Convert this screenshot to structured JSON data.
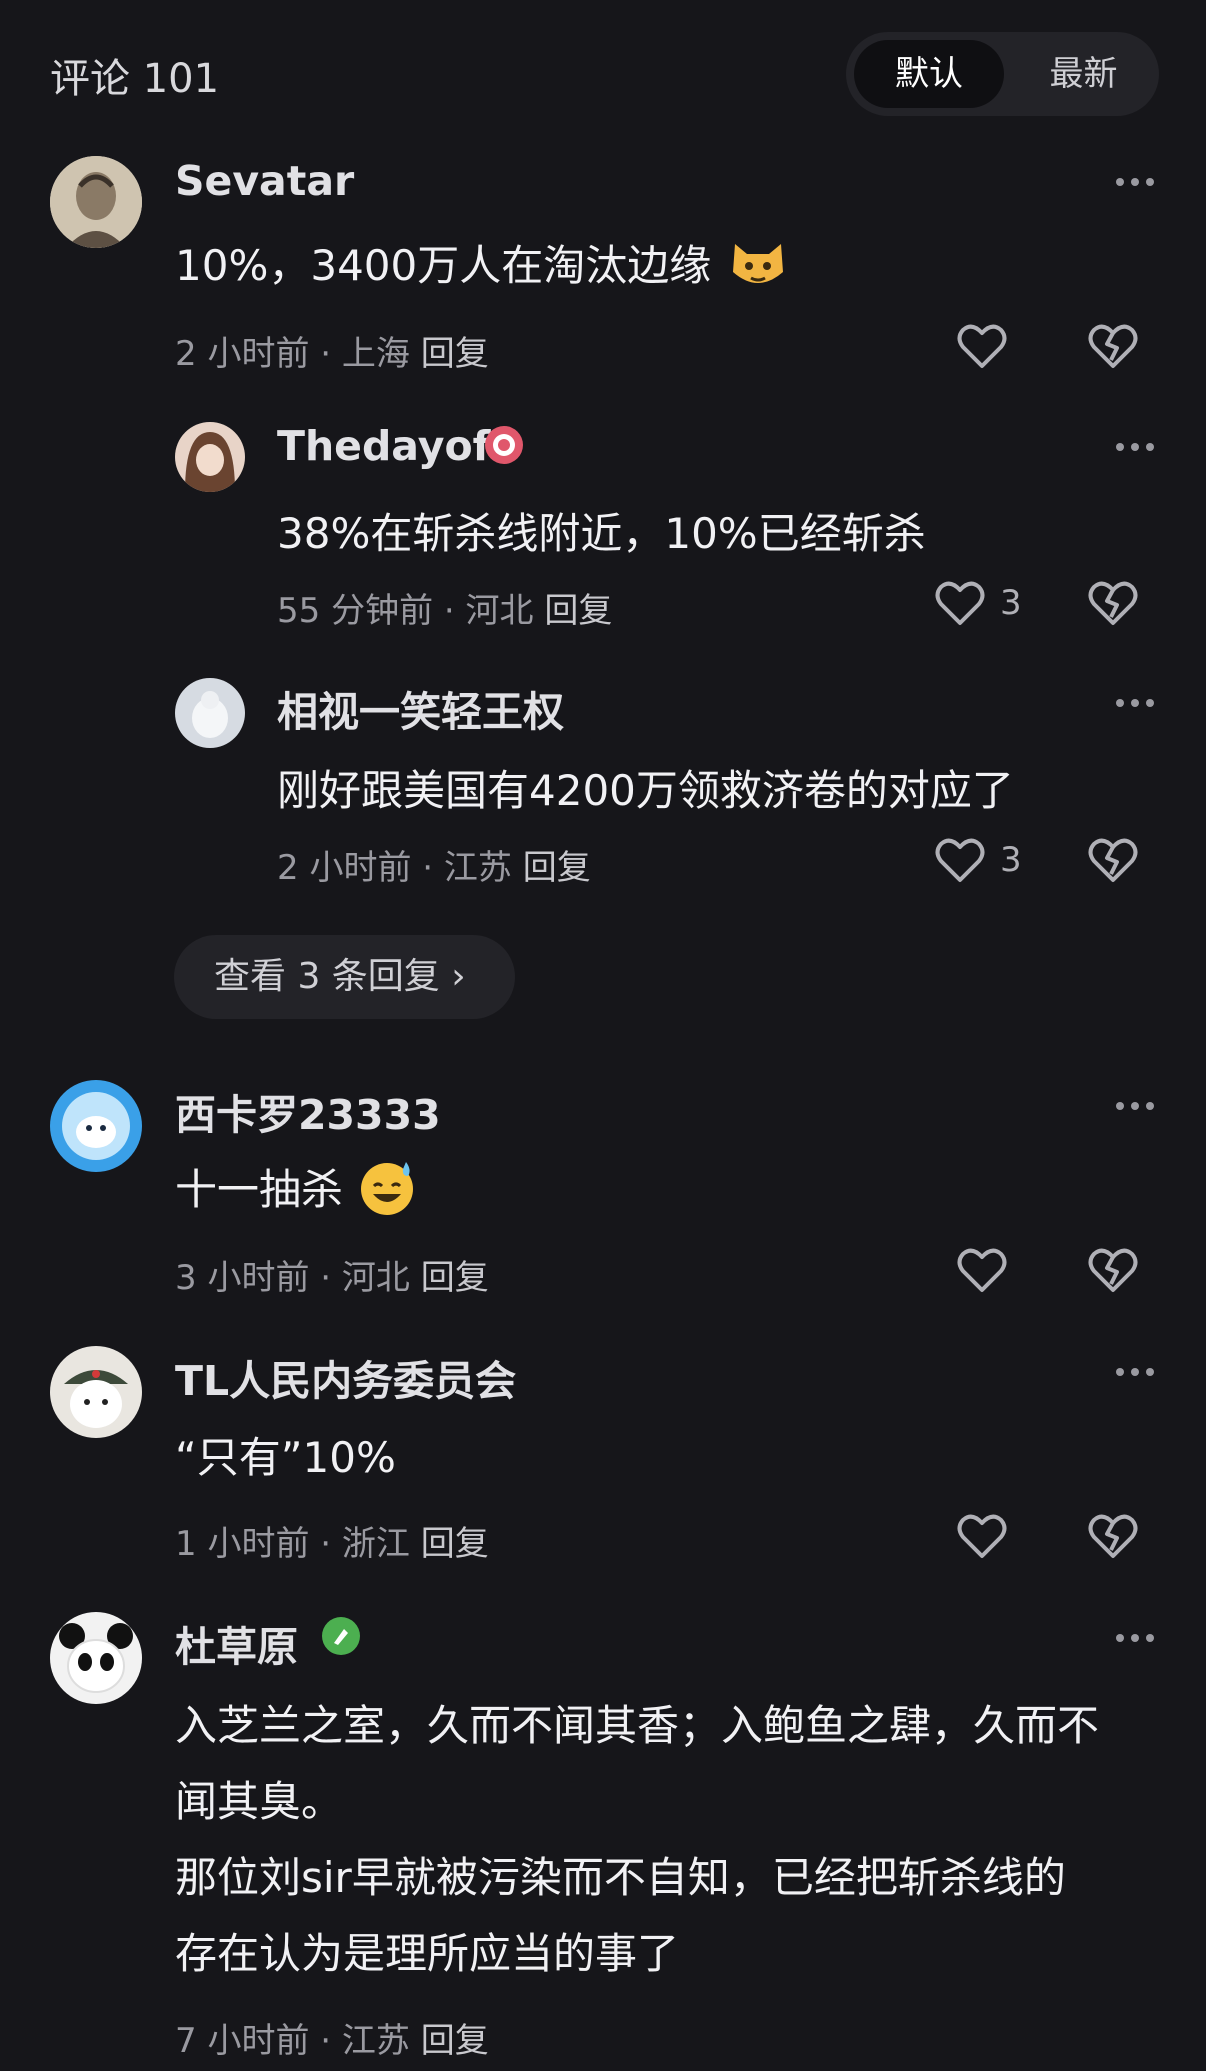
{
  "header": {
    "title": "评论 101",
    "sort_default": "默认",
    "sort_latest": "最新"
  },
  "comments": [
    {
      "username": "Sevatar",
      "content": "10%，3400万人在淘汰边缘",
      "time": "2 小时前",
      "location": "上海",
      "reply_label": "回复",
      "likes": ""
    },
    {
      "username": "Thedayof",
      "content": "38%在斩杀线附近，10%已经斩杀",
      "time": "55 分钟前",
      "location": "河北",
      "reply_label": "回复",
      "likes": "3"
    },
    {
      "username": "相视一笑轻王权",
      "content": "刚好跟美国有4200万领救济卷的对应了",
      "time": "2 小时前",
      "location": "江苏",
      "reply_label": "回复",
      "likes": "3"
    },
    {
      "username": "西卡罗23333",
      "content": "十一抽杀",
      "time": "3 小时前",
      "location": "河北",
      "reply_label": "回复",
      "likes": ""
    },
    {
      "username": "TL人民内务委员会",
      "content": "“只有”10%",
      "time": "1 小时前",
      "location": "浙江",
      "reply_label": "回复",
      "likes": ""
    },
    {
      "username": "杜草原",
      "content_lines": [
        "入芝兰之室，久而不闻其香；入鲍鱼之肆，久而不",
        "闻其臭。",
        "那位刘sir早就被污染而不自知，已经把斩杀线的",
        "存在认为是理所应当的事了"
      ],
      "time": "7 小时前",
      "location": "江苏",
      "reply_label": "回复"
    }
  ],
  "view_replies": "查看 3 条回复 ›",
  "meta_separator": " · ",
  "icons": {
    "more": "more-dots-icon",
    "like": "heart-icon",
    "dislike": "broken-heart-icon"
  },
  "colors": {
    "background": "#16161a",
    "pill": "#232328",
    "meta_text": "#9a9aa1"
  }
}
